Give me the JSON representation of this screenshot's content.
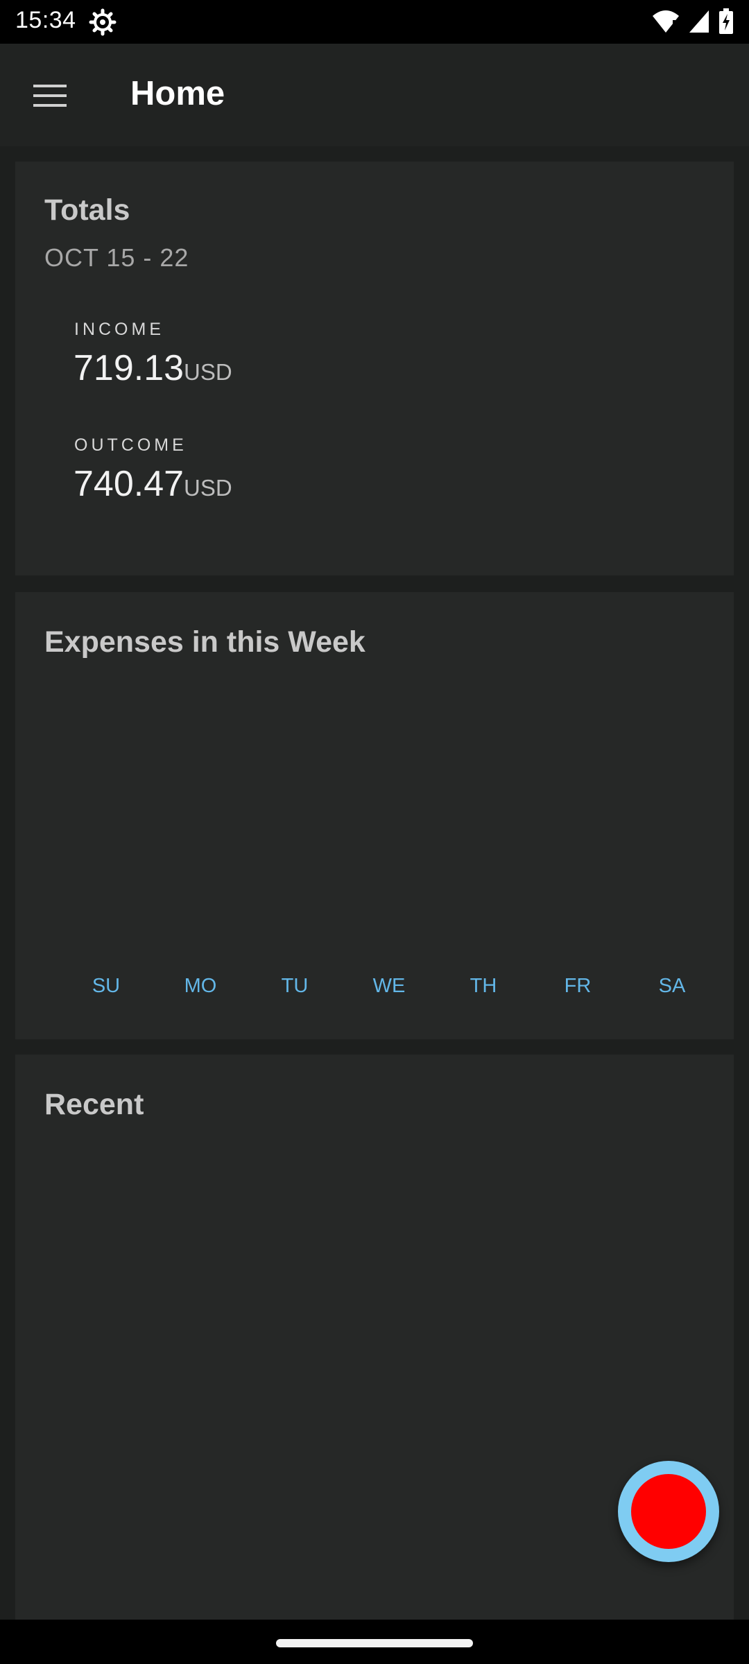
{
  "status_bar": {
    "time": "15:34",
    "icons": [
      "settings-gear-icon",
      "wifi-icon",
      "signal-icon",
      "battery-charging-icon"
    ]
  },
  "app_bar": {
    "title": "Home",
    "menu_icon": "hamburger-menu-icon"
  },
  "totals": {
    "heading": "Totals",
    "date_range": "OCT 15 - 22",
    "income": {
      "label": "INCOME",
      "value": "719.13",
      "unit": "USD"
    },
    "outcome": {
      "label": "OUTCOME",
      "value": "740.47",
      "unit": "USD"
    }
  },
  "week": {
    "heading": "Expenses in this Week",
    "days": [
      "SU",
      "MO",
      "TU",
      "WE",
      "TH",
      "FR",
      "SA"
    ]
  },
  "recent": {
    "heading": "Recent"
  },
  "fab": {
    "icon": "record-icon"
  },
  "colors": {
    "background": "#1d1f1e",
    "card": "#262827",
    "accent": "#63b7e8",
    "fab_ring": "#7fccf2",
    "fab_center": "#ff0000"
  }
}
